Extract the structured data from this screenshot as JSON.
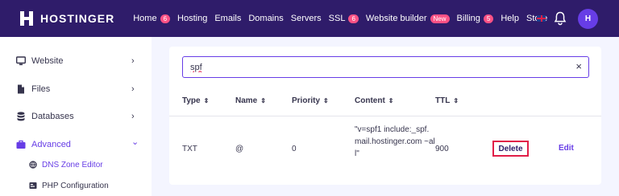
{
  "brand": {
    "name": "HOSTINGER",
    "avatar_letter": "H"
  },
  "nav": [
    {
      "label": "Home",
      "badge": "6"
    },
    {
      "label": "Hosting",
      "badge": null
    },
    {
      "label": "Emails",
      "badge": null
    },
    {
      "label": "Domains",
      "badge": null
    },
    {
      "label": "Servers",
      "badge": null
    },
    {
      "label": "SSL",
      "badge": "6"
    },
    {
      "label": "Website builder",
      "badge": "New"
    },
    {
      "label": "Billing",
      "badge": "5"
    },
    {
      "label": "Help",
      "badge": null
    },
    {
      "label": "Store",
      "badge": null
    }
  ],
  "sidebar": {
    "items": [
      {
        "label": "Website",
        "chevron": "›",
        "icon": "monitor-icon"
      },
      {
        "label": "Files",
        "chevron": "›",
        "icon": "file-icon"
      },
      {
        "label": "Databases",
        "chevron": "›",
        "icon": "database-icon"
      },
      {
        "label": "Advanced",
        "chevron": "⌄",
        "icon": "briefcase-icon"
      }
    ],
    "subitems": [
      {
        "label": "DNS Zone Editor",
        "icon": "dns-icon"
      },
      {
        "label": "PHP Configuration",
        "icon": "php-icon"
      }
    ]
  },
  "search": {
    "value": "spf",
    "clear": "×"
  },
  "table": {
    "headers": [
      "Type",
      "Name",
      "Priority",
      "Content",
      "TTL"
    ],
    "sort_glyph": "⇕",
    "rows": [
      {
        "type": "TXT",
        "name": "@",
        "priority": "0",
        "content": "\"v=spf1 include:_spf.mail.hostinger.com ~all\"",
        "ttl": "900",
        "delete_label": "Delete",
        "edit_label": "Edit"
      }
    ]
  },
  "colors": {
    "topbar": "#2f1c6a",
    "accent": "#673de6",
    "badge": "#fc5185",
    "highlight": "#e11d48"
  }
}
